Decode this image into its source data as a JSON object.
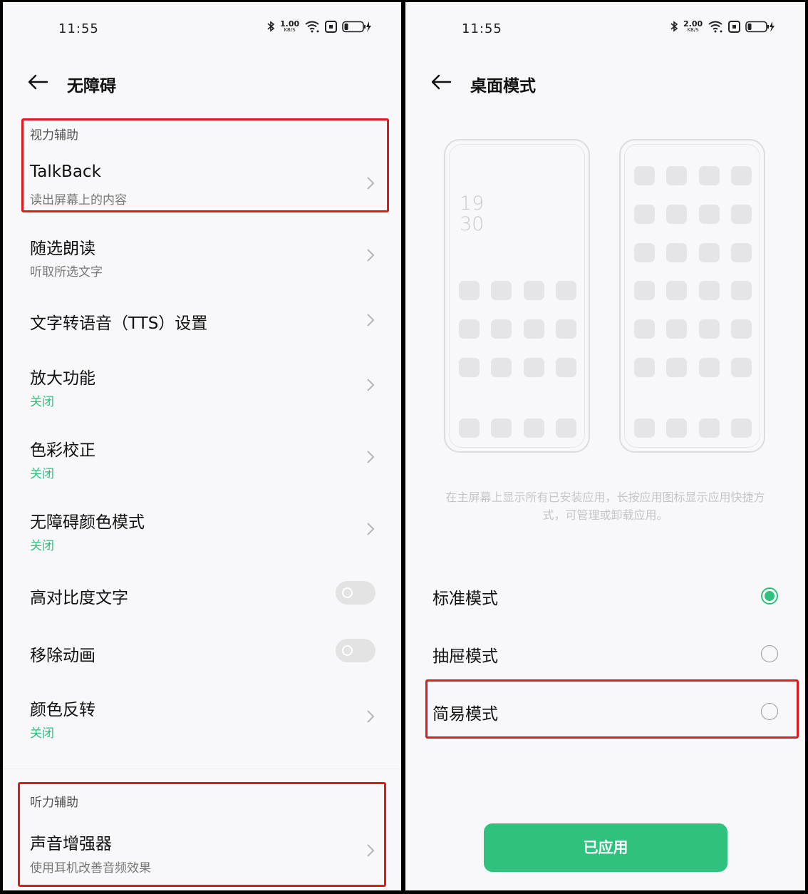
{
  "left_screen": {
    "status_bar": {
      "time": "11:55",
      "net_speed": "1.00",
      "net_unit": "KB/S"
    },
    "title": "无障碍",
    "vision_section": {
      "label": "视力辅助",
      "talkback": {
        "title": "TalkBack",
        "subtitle": "读出屏幕上的内容"
      }
    },
    "items": [
      {
        "title": "随选朗读",
        "subtitle": "听取所选文字"
      },
      {
        "title": "文字转语音（TTS）设置"
      },
      {
        "title": "放大功能",
        "status": "关闭"
      },
      {
        "title": "色彩校正",
        "status": "关闭"
      },
      {
        "title": "无障碍颜色模式",
        "status": "关闭"
      },
      {
        "title": "高对比度文字",
        "toggle_on": false
      },
      {
        "title": "移除动画",
        "toggle_on": false
      },
      {
        "title": "颜色反转",
        "status": "关闭"
      }
    ],
    "hearing_section": {
      "label": "听力辅助",
      "sound_amplifier": {
        "title": "声音增强器",
        "subtitle": "使用耳机改善音频效果"
      }
    }
  },
  "right_screen": {
    "status_bar": {
      "time": "11:55",
      "net_speed": "2.00",
      "net_unit": "KB/S"
    },
    "title": "桌面模式",
    "preview": {
      "clock_hour": "19",
      "clock_minute": "30"
    },
    "description": "在主屏幕上显示所有已安装应用，长按应用图标显示应用快捷方式，可管理或卸载应用。",
    "modes": [
      {
        "label": "标准模式",
        "selected": true
      },
      {
        "label": "抽屉模式",
        "selected": false
      },
      {
        "label": "简易模式",
        "selected": false
      }
    ],
    "apply_button": "已应用"
  },
  "colors": {
    "accent_green": "#2ec27e",
    "highlight_red": "#e01a1a",
    "background": "#f8f8fa"
  }
}
